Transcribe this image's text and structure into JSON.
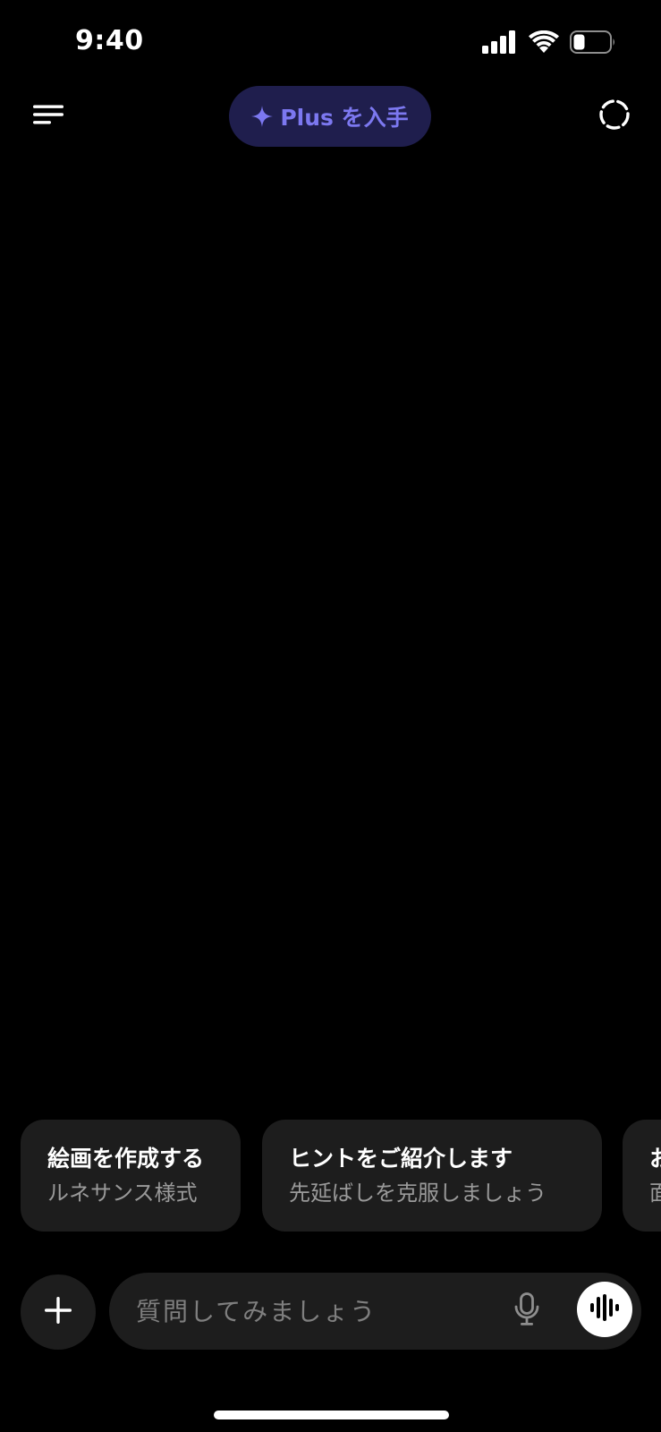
{
  "status_bar": {
    "time": "9:40",
    "icons": [
      "cellular-signal-icon",
      "wifi-icon",
      "battery-icon"
    ]
  },
  "header": {
    "menu_icon": "menu-icon",
    "upgrade_label": "Plus を入手",
    "upgrade_icon": "sparkle-icon",
    "temporary_chat_icon": "dashed-circle-icon"
  },
  "suggestions": [
    {
      "title": "絵画を作成する",
      "subtitle": "ルネサンス様式"
    },
    {
      "title": "ヒントをご紹介します",
      "subtitle": "先延ばしを克服しましょう"
    },
    {
      "title": "お",
      "subtitle": "面"
    }
  ],
  "composer": {
    "attach_icon": "plus-icon",
    "placeholder": "質問してみましょう",
    "mic_icon": "microphone-icon",
    "voice_icon": "voice-waveform-icon"
  },
  "colors": {
    "background": "#000000",
    "surface": "#1d1d1d",
    "accent": "#7c78f0",
    "accent_bg": "#1f1e4d",
    "text_secondary": "#9a9a9a"
  }
}
